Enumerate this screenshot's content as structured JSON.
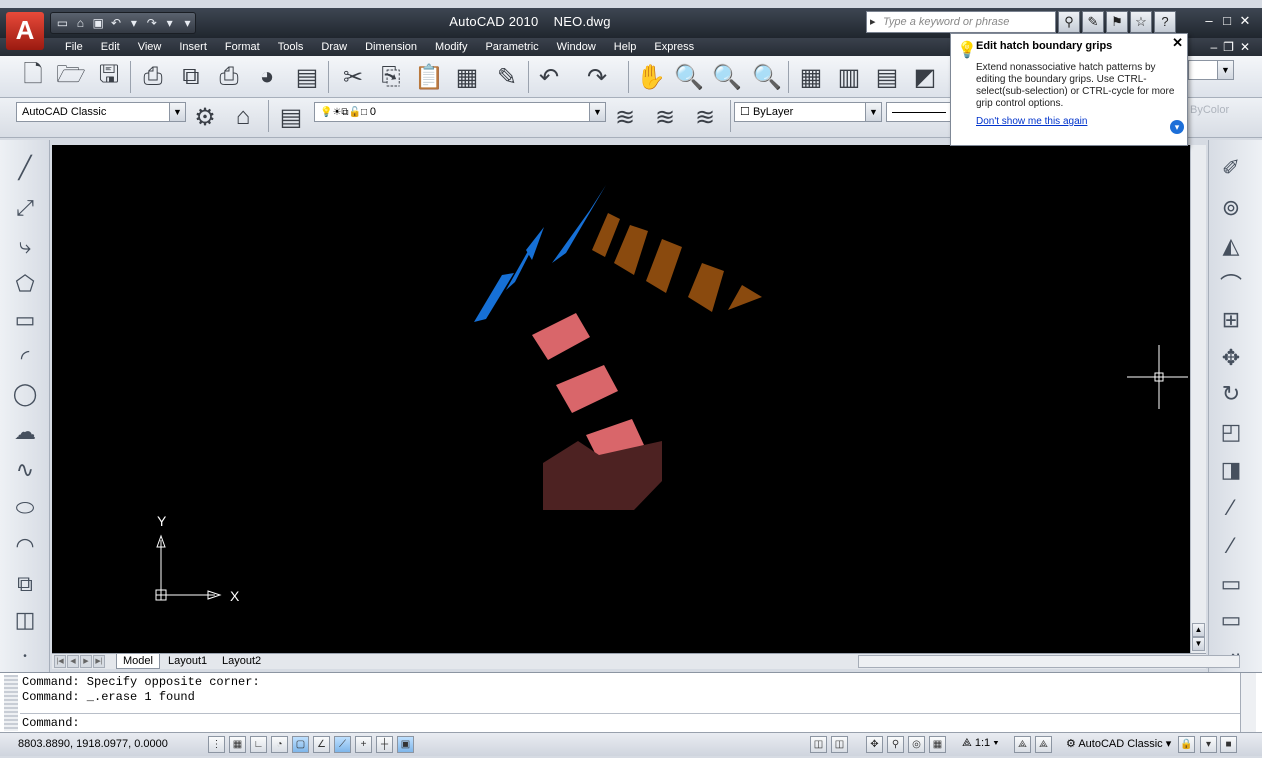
{
  "app": {
    "logo": "A",
    "title": "AutoCAD 2010",
    "filename": "NEO.dwg"
  },
  "search": {
    "placeholder": "Type a keyword or phrase"
  },
  "menu": [
    "File",
    "Edit",
    "View",
    "Insert",
    "Format",
    "Tools",
    "Draw",
    "Dimension",
    "Modify",
    "Parametric",
    "Window",
    "Help",
    "Express"
  ],
  "toolbar2": {
    "workspace": "AutoCAD Classic",
    "layer": "0",
    "color": "ByLayer",
    "plotstyle": "ByColor"
  },
  "balloon": {
    "title": "Edit hatch boundary grips",
    "body": "Extend nonassociative hatch patterns by editing the boundary grips. Use CTRL-select(sub-selection) or CTRL-cycle for more grip control options.",
    "link": "Don't show me this again"
  },
  "ucs": {
    "x_label": "X",
    "y_label": "Y"
  },
  "tabs": [
    "Model",
    "Layout1",
    "Layout2"
  ],
  "command": {
    "line1": "Command: Specify opposite corner:",
    "line2": "Command: _.erase 1 found",
    "prompt": "Command:"
  },
  "status": {
    "coordinates": "8803.8890, 1918.0977, 0.0000",
    "annotation_scale": "1:1",
    "workspace": "AutoCAD Classic"
  },
  "colors": {
    "canvas": "#000000",
    "blue_hatch": "#1670d6",
    "brown_hatch": "#8a4a0e",
    "pink_hatch": "#d9666a",
    "dark_block": "#4d2222"
  }
}
